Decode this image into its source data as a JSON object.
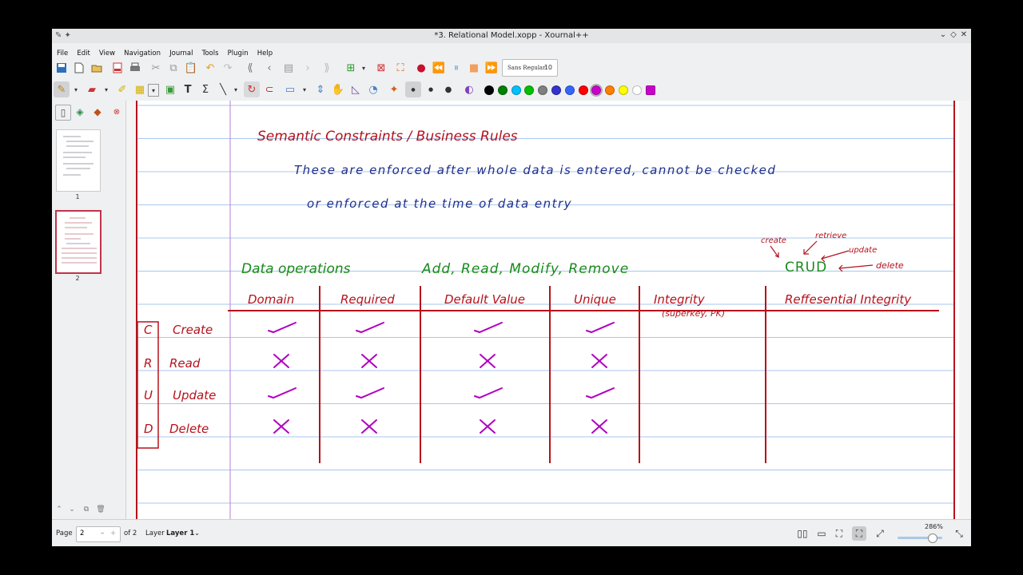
{
  "window": {
    "title": "*3. Relational Model.xopp - Xournal++",
    "controls": [
      "⌄",
      "◇",
      "✕"
    ]
  },
  "menu": [
    "File",
    "Edit",
    "View",
    "Navigation",
    "Journal",
    "Tools",
    "Plugin",
    "Help"
  ],
  "toolbar": {
    "font_name": "Sans Regular",
    "font_size": "10",
    "colors": [
      "#000000",
      "#008000",
      "#00c0ff",
      "#00c000",
      "#808080",
      "#3333cc",
      "#3366ff",
      "#ff0000",
      "#cc00cc",
      "#ff8000",
      "#ffff00",
      "#ffffff",
      "#cc00cc"
    ]
  },
  "sidebar": {
    "pages": [
      "1",
      "2"
    ],
    "selected_page": "2"
  },
  "note": {
    "heading": "Semantic Constraints / Business Rules",
    "line1": "These are enforced after whole data is entered, cannot be checked",
    "line2": "or enforced at the time of data entry",
    "data_ops": "Data operations",
    "ops_list": "Add, Read, Modify, Remove",
    "crud": "CRUD",
    "crud_create": "create",
    "crud_retrieve": "retrieve",
    "crud_update": "update",
    "crud_delete": "delete",
    "columns": [
      "Domain",
      "Required",
      "Default Value",
      "Unique",
      "Integrity",
      "Reffesential Integrity"
    ],
    "integrity_sub": "(superkey, PK)",
    "rows": [
      {
        "letter": "C",
        "label": "Create",
        "marks": [
          "check",
          "check",
          "check",
          "check"
        ]
      },
      {
        "letter": "R",
        "label": "Read",
        "marks": [
          "cross",
          "cross",
          "cross",
          "cross"
        ]
      },
      {
        "letter": "U",
        "label": "Update",
        "marks": [
          "check",
          "check",
          "check",
          "check"
        ]
      },
      {
        "letter": "D",
        "label": "Delete",
        "marks": [
          "cross",
          "cross",
          "cross",
          "cross"
        ]
      }
    ],
    "ink_blue": "#1e2f8c",
    "ink_red": "#b5121b",
    "ink_green": "#1a8a1a",
    "ink_magenta": "#b000c0"
  },
  "status": {
    "page_label": "Page",
    "page_value": "2",
    "page_of": "of 2",
    "layer_label": "Layer",
    "layer_value": "Layer 1",
    "zoom": "286%"
  }
}
